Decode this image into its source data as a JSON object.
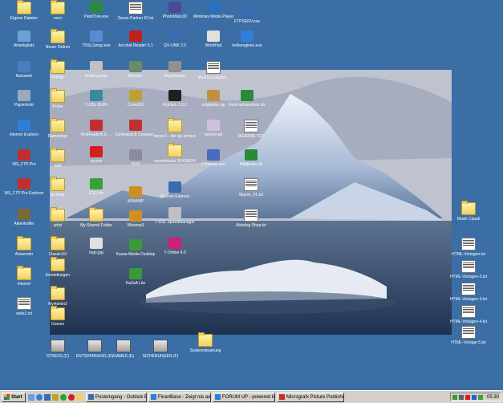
{
  "desktop_icons": [
    {
      "name": "eigene-dateien-icon",
      "label": "Eigene Dateien",
      "type": "folder",
      "color": "#f0d060"
    },
    {
      "name": "arbeitsplatz-icon",
      "label": "Arbeitsplatz",
      "type": "app",
      "color": "#6ea0d8"
    },
    {
      "name": "netzwerk-icon",
      "label": "Netzwerk",
      "type": "app",
      "color": "#4a7cc0"
    },
    {
      "name": "papierkorb-icon",
      "label": "Papierkorb",
      "type": "app",
      "color": "#9ab"
    },
    {
      "name": "internet-explorer-icon",
      "label": "Internet Explorer",
      "type": "app",
      "color": "#2f7fd8"
    },
    {
      "name": "ws-ftp-pro-icon",
      "label": "WS_FTP Pro",
      "type": "app",
      "color": "#c03030"
    },
    {
      "name": "ws-ftp-pro-explorer-icon",
      "label": "WS_FTP Pro Explorer",
      "type": "app",
      "color": "#c03030"
    },
    {
      "name": "aktenkoffer-icon",
      "label": "Aktenkoffer",
      "type": "app",
      "color": "#7a6a3a"
    },
    {
      "name": "anwender-icon",
      "label": "Anwender",
      "type": "folder"
    },
    {
      "name": "internet-icon",
      "label": "Internet",
      "type": "folder"
    },
    {
      "name": "seite1-icon",
      "label": "seite1.txt",
      "type": "doc"
    },
    {
      "name": "euro-icon",
      "label": "euro",
      "type": "folder"
    },
    {
      "name": "neuer-ordner-icon",
      "label": "Neuer Ordner",
      "type": "folder"
    },
    {
      "name": "phpkit-icon",
      "label": "PHPkit",
      "type": "folder"
    },
    {
      "name": "probe-icon",
      "label": "Probe",
      "type": "folder"
    },
    {
      "name": "rameshop-icon",
      "label": "Rameshop",
      "type": "folder"
    },
    {
      "name": "tool-icon",
      "label": "tool",
      "type": "folder"
    },
    {
      "name": "tp-shop-icon",
      "label": "tp-shop",
      "type": "folder"
    },
    {
      "name": "artist-icon",
      "label": "artist",
      "type": "folder"
    },
    {
      "name": "classic-icon",
      "label": "ClassicXX",
      "type": "folder"
    },
    {
      "name": "einstellungen-icon",
      "label": "Einstellungen",
      "type": "folder"
    },
    {
      "name": "myadmin-icon",
      "label": "MyAdmin2",
      "type": "folder"
    },
    {
      "name": "games-icon",
      "label": "Games",
      "type": "folder"
    },
    {
      "name": "painttree-icon",
      "label": "PaintTree.exe",
      "type": "app",
      "color": "#2a8a3a"
    },
    {
      "name": "tdslsetup-icon",
      "label": "TDSLSetup.exe",
      "type": "app",
      "color": "#5a8ad0"
    },
    {
      "name": "eisberg-bmp-icon",
      "label": "Eisberg.bmp",
      "type": "app",
      "color": "#c0c0c0"
    },
    {
      "name": "t-dsl-duin-icon",
      "label": "T-DSL DUIN",
      "type": "app",
      "color": "#3a8a9a"
    },
    {
      "name": "acoreader-icon",
      "label": "AcoReader5.0_...",
      "type": "app",
      "color": "#c03030"
    },
    {
      "name": "ex-exe-icon",
      "label": "ex.exe",
      "type": "app",
      "color": "#d02020"
    },
    {
      "name": "icq-lite-icon",
      "label": "ICQ Lite",
      "type": "app",
      "color": "#3aa03a"
    },
    {
      "name": "my-shared-folder-icon",
      "label": "My Shared Folder",
      "type": "folder"
    },
    {
      "name": "logo-jpg-icon",
      "label": "logo.jpg",
      "type": "app",
      "color": "#e0e0e0"
    },
    {
      "name": "zanox-partner-icon",
      "label": "Zanox-Partner ID.txt",
      "type": "doc"
    },
    {
      "name": "acrobat-reader-icon",
      "label": "Acrobat Reader 5.1",
      "type": "app",
      "color": "#c02020"
    },
    {
      "name": "brenner-icon",
      "label": "Brenner",
      "type": "app",
      "color": "#6a8a6a"
    },
    {
      "name": "clonecd-icon",
      "label": "CloneCD",
      "type": "app",
      "color": "#c0a030"
    },
    {
      "name": "command-conquer-icon",
      "label": "Command & Conquer...",
      "type": "app",
      "color": "#c03030"
    },
    {
      "name": "dvd-icon",
      "label": "DVD",
      "type": "app",
      "color": "#8a8aa0"
    },
    {
      "name": "winamp-icon",
      "label": "WINAMP",
      "type": "app",
      "color": "#d09020"
    },
    {
      "name": "winamp3-icon",
      "label": "Winamp3",
      "type": "app",
      "color": "#d09020"
    },
    {
      "name": "kazaa-media-desktop-icon",
      "label": "Kazaa Media Desktop",
      "type": "app",
      "color": "#3a9a3a"
    },
    {
      "name": "kazaa-lite-icon",
      "label": "KaZaA Lite",
      "type": "app",
      "color": "#3a9a3a"
    },
    {
      "name": "photoware-icon",
      "label": "PhotoWare30",
      "type": "app",
      "color": "#4a4a9a"
    },
    {
      "name": "qv-link-icon",
      "label": "QV-LINK 2.0",
      "type": "app",
      "color": "#3a6ab0"
    },
    {
      "name": "regcleaner-icon",
      "label": "RegCleaner",
      "type": "app",
      "color": "#909090"
    },
    {
      "name": "fipcam-icon",
      "label": "FipCam 1.3.2",
      "type": "app",
      "color": "#202020"
    },
    {
      "name": "server1-icon",
      "label": "server1 - der ap archive",
      "type": "folder"
    },
    {
      "name": "soundstudio-icon",
      "label": "soundstudio JUKEBOX",
      "type": "folder"
    },
    {
      "name": "outlook-express-icon",
      "label": "Outlook Express",
      "type": "app",
      "color": "#3a6ab0"
    },
    {
      "name": "t-dsl-speedmanager-icon",
      "label": "T-DSL Speedmanager",
      "type": "app",
      "color": "#c0c0c0"
    },
    {
      "name": "t-online-icon",
      "label": "T-Online 4.0",
      "type": "app",
      "color": "#d0207a"
    },
    {
      "name": "windows-media-player-icon",
      "label": "Windows Media Player",
      "type": "app",
      "color": "#2a70c0"
    },
    {
      "name": "wordpad-icon",
      "label": "WordPad",
      "type": "app",
      "color": "#e0e0e0"
    },
    {
      "name": "shortcut-playlist-icon",
      "label": "shortcut playlist...",
      "type": "doc"
    },
    {
      "name": "nkglieder-zip-icon",
      "label": "mitglieder.zip",
      "type": "app",
      "color": "#c09040"
    },
    {
      "name": "banner-gif-icon",
      "label": "banner.gif",
      "type": "app",
      "color": "#d0c0e0"
    },
    {
      "name": "ph-setup-icon",
      "label": "PHSetup.exe",
      "type": "app",
      "color": "#4a6ac0"
    },
    {
      "name": "fdb-icon",
      "label": "FTPSERV.exe",
      "type": "app",
      "color": "#3a6ab0"
    },
    {
      "name": "hellsengine-icon",
      "label": "hellsengines.exe",
      "type": "app",
      "color": "#2f7fd8"
    },
    {
      "name": "funk-verzeichnis-icon",
      "label": "Funk-verzeichnis.xls",
      "type": "app",
      "color": "#2a8a3a"
    },
    {
      "name": "readme-icon",
      "label": "README.TXT",
      "type": "doc"
    },
    {
      "name": "mitglieder-xls-icon",
      "label": "Mitglieder.xls",
      "type": "app",
      "color": "#2a8a3a"
    },
    {
      "name": "maxim-txt-icon",
      "label": "Maxim_01.txt",
      "type": "doc"
    },
    {
      "name": "metafog-txt-icon",
      "label": "Metafog Shop.txt",
      "type": "doc"
    },
    {
      "name": "musik-claudi-icon",
      "label": "Musik Claudi",
      "type": "folder"
    },
    {
      "name": "html-vorlagen-icon",
      "label": "HTML-Vorlagen.txt",
      "type": "doc"
    },
    {
      "name": "html-vorlagen2-icon",
      "label": "HTML-Vorlagen-2.txt",
      "type": "doc"
    },
    {
      "name": "html-vorlagen3-icon",
      "label": "HTML-Vorlagen-3.txt",
      "type": "doc"
    },
    {
      "name": "html-vorlagen4-icon",
      "label": "HTML-Vorlagen-4.txt",
      "type": "doc"
    },
    {
      "name": "html-vorlage5-icon",
      "label": "HTML-Vorlage-5.txt",
      "type": "doc"
    },
    {
      "name": "stress-drive-icon",
      "label": "STRESS (C)",
      "type": "drive"
    },
    {
      "name": "entspannung-drive-icon",
      "label": "ENTSPANNUNG (D)",
      "type": "drive"
    },
    {
      "name": "games-drive-icon",
      "label": "GAMES (E)",
      "type": "drive"
    },
    {
      "name": "sicherungen-drive-icon",
      "label": "SICHERUNGEN (F)",
      "type": "drive"
    },
    {
      "name": "systemsteuerung-icon",
      "label": "Systemsteuerung",
      "type": "folder"
    }
  ],
  "taskbar": {
    "start_label": "Start",
    "tasks": [
      {
        "label": "Posteingang - Outlook Exp...",
        "color": "#3a6ab0"
      },
      {
        "label": "FinanBase - Zeigt nie aues...",
        "color": "#2f7fd8"
      },
      {
        "label": "FORUM UP - powered by...",
        "color": "#2f7fd8"
      },
      {
        "label": "Micrografx Picture Publisher",
        "color": "#c03030"
      }
    ],
    "clock": "05:30"
  }
}
